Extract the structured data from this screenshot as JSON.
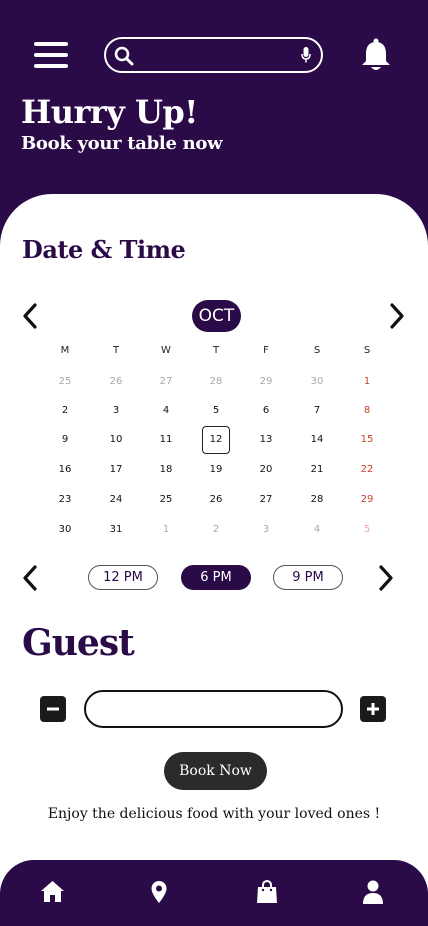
{
  "header": {
    "title": "Hurry Up!",
    "subtitle": "Book your table now",
    "search": {
      "placeholder": "",
      "value": ""
    },
    "icons": [
      "hamburger-menu-icon",
      "search-icon",
      "microphone-icon",
      "bell-icon"
    ]
  },
  "booking": {
    "section_title": "Date & Time",
    "calendar": {
      "month": "OCT",
      "weekdays": [
        "M",
        "T",
        "W",
        "T",
        "F",
        "S",
        "S"
      ],
      "weeks": [
        [
          {
            "d": "25",
            "m": true
          },
          {
            "d": "26",
            "m": true
          },
          {
            "d": "27",
            "m": true
          },
          {
            "d": "28",
            "m": true
          },
          {
            "d": "29",
            "m": true
          },
          {
            "d": "30",
            "m": true
          },
          {
            "d": "1",
            "m": false
          }
        ],
        [
          {
            "d": "2",
            "m": false
          },
          {
            "d": "3",
            "m": false
          },
          {
            "d": "4",
            "m": false
          },
          {
            "d": "5",
            "m": false
          },
          {
            "d": "6",
            "m": false
          },
          {
            "d": "7",
            "m": false
          },
          {
            "d": "8",
            "m": false
          }
        ],
        [
          {
            "d": "9",
            "m": false
          },
          {
            "d": "10",
            "m": false
          },
          {
            "d": "11",
            "m": false
          },
          {
            "d": "12",
            "m": false,
            "selected": true
          },
          {
            "d": "13",
            "m": false
          },
          {
            "d": "14",
            "m": false
          },
          {
            "d": "15",
            "m": false
          }
        ],
        [
          {
            "d": "16",
            "m": false
          },
          {
            "d": "17",
            "m": false
          },
          {
            "d": "18",
            "m": false
          },
          {
            "d": "19",
            "m": false
          },
          {
            "d": "20",
            "m": false
          },
          {
            "d": "21",
            "m": false
          },
          {
            "d": "22",
            "m": false
          }
        ],
        [
          {
            "d": "23",
            "m": false
          },
          {
            "d": "24",
            "m": false
          },
          {
            "d": "25",
            "m": false
          },
          {
            "d": "26",
            "m": false
          },
          {
            "d": "27",
            "m": false
          },
          {
            "d": "28",
            "m": false
          },
          {
            "d": "29",
            "m": false
          }
        ],
        [
          {
            "d": "30",
            "m": false
          },
          {
            "d": "31",
            "m": false
          },
          {
            "d": "1",
            "m": true
          },
          {
            "d": "2",
            "m": true
          },
          {
            "d": "3",
            "m": true
          },
          {
            "d": "4",
            "m": true
          },
          {
            "d": "5",
            "m": true
          }
        ]
      ]
    },
    "times": [
      {
        "label": "12 PM",
        "active": false
      },
      {
        "label": "6 PM",
        "active": true
      },
      {
        "label": "9 PM",
        "active": false
      }
    ]
  },
  "guest": {
    "title": "Guest",
    "count_value": "",
    "decrement_icon": "minus-icon",
    "increment_icon": "plus-icon"
  },
  "actions": {
    "book_label": "Book Now",
    "tagline": "Enjoy the delicious food with your loved ones !"
  },
  "bottom_nav": {
    "items": [
      "home-icon",
      "location-pin-icon",
      "shopping-bag-icon",
      "profile-icon"
    ]
  },
  "colors": {
    "brand": "#2a0a47",
    "sunday": "#c8412b",
    "muted": "#a9a9a9",
    "button_dark": "#2b2b2b"
  }
}
